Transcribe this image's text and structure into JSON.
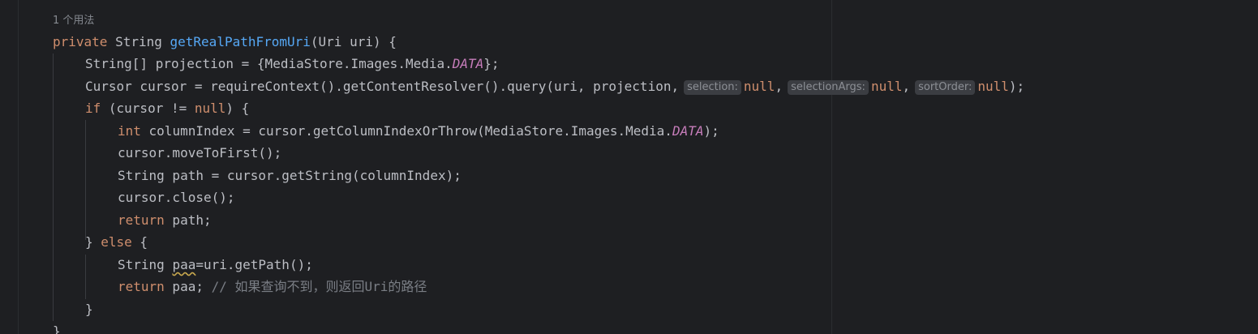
{
  "usage_hint": "1 个用法",
  "code": {
    "l1": {
      "kw": "private",
      "type": "String",
      "fn": "getRealPathFromUri",
      "rest": "(Uri uri) {"
    },
    "l2": {
      "pre": "String[] projection = {MediaStore.Images.Media.",
      "const": "DATA",
      "post": "};"
    },
    "l3": {
      "pre": "Cursor cursor = requireContext().getContentResolver().query(uri, projection,",
      "hint1": "selection:",
      "null1": "null",
      "sep1": ",",
      "hint2": "selectionArgs:",
      "null2": "null",
      "sep2": ",",
      "hint3": "sortOrder:",
      "null3": "null",
      "post": ");"
    },
    "l4": {
      "kw": "if",
      "pre": " (cursor != ",
      "null": "null",
      "post": ") {"
    },
    "l5": {
      "kw": "int",
      "pre": " columnIndex = cursor.getColumnIndexOrThrow(MediaStore.Images.Media.",
      "const": "DATA",
      "post": ");"
    },
    "l6": {
      "text": "cursor.moveToFirst();"
    },
    "l7": {
      "text": "String path = cursor.getString(columnIndex);"
    },
    "l8": {
      "text": "cursor.close();"
    },
    "l9": {
      "kw": "return",
      "post": " path;"
    },
    "l10": {
      "pre": "} ",
      "kw": "else",
      "post": " {"
    },
    "l11": {
      "pre": "String ",
      "var": "paa",
      "post": "=uri.getPath();"
    },
    "l12": {
      "kw": "return",
      "post": " paa; ",
      "comment": "// 如果查询不到，则返回Uri的路径"
    },
    "l13": {
      "text": "}"
    },
    "l14": {
      "text": "}"
    }
  }
}
